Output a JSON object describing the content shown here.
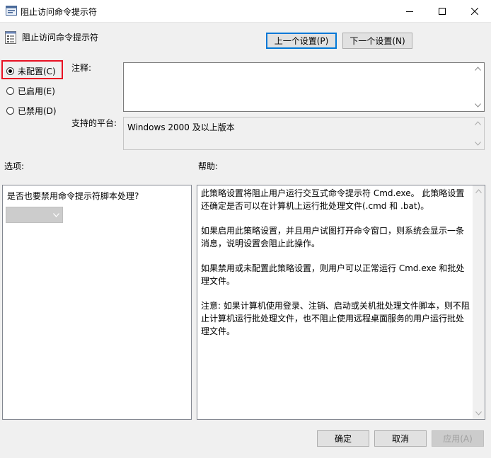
{
  "window": {
    "title": "阻止访问命令提示符",
    "minimize_label": "minimize",
    "maximize_label": "maximize",
    "close_label": "close"
  },
  "header": {
    "policy_title": "阻止访问命令提示符",
    "prev_button": "上一个设置(P)",
    "next_button": "下一个设置(N)"
  },
  "state": {
    "options": [
      {
        "label": "未配置(C)",
        "checked": true
      },
      {
        "label": "已启用(E)",
        "checked": false
      },
      {
        "label": "已禁用(D)",
        "checked": false
      }
    ]
  },
  "comment": {
    "label": "注释:",
    "value": ""
  },
  "platform": {
    "label": "支持的平台:",
    "value": "Windows 2000 及以上版本"
  },
  "options_section": {
    "label": "选项:",
    "question": "是否也要禁用命令提示符脚本处理?",
    "dropdown_value": ""
  },
  "help_section": {
    "label": "帮助:",
    "paragraphs": [
      "此策略设置将阻止用户运行交互式命令提示符 Cmd.exe。 此策略设置还确定是否可以在计算机上运行批处理文件(.cmd 和 .bat)。",
      "如果启用此策略设置，并且用户试图打开命令窗口，则系统会显示一条消息，说明设置会阻止此操作。",
      "如果禁用或未配置此策略设置，则用户可以正常运行 Cmd.exe 和批处理文件。",
      "注意: 如果计算机使用登录、注销、启动或关机批处理文件脚本，则不阻止计算机运行批处理文件，也不阻止使用远程桌面服务的用户运行批处理文件。"
    ]
  },
  "footer": {
    "ok": "确定",
    "cancel": "取消",
    "apply": "应用(A)"
  },
  "colors": {
    "highlight": "#e81123",
    "primary_border": "#0078d7"
  }
}
